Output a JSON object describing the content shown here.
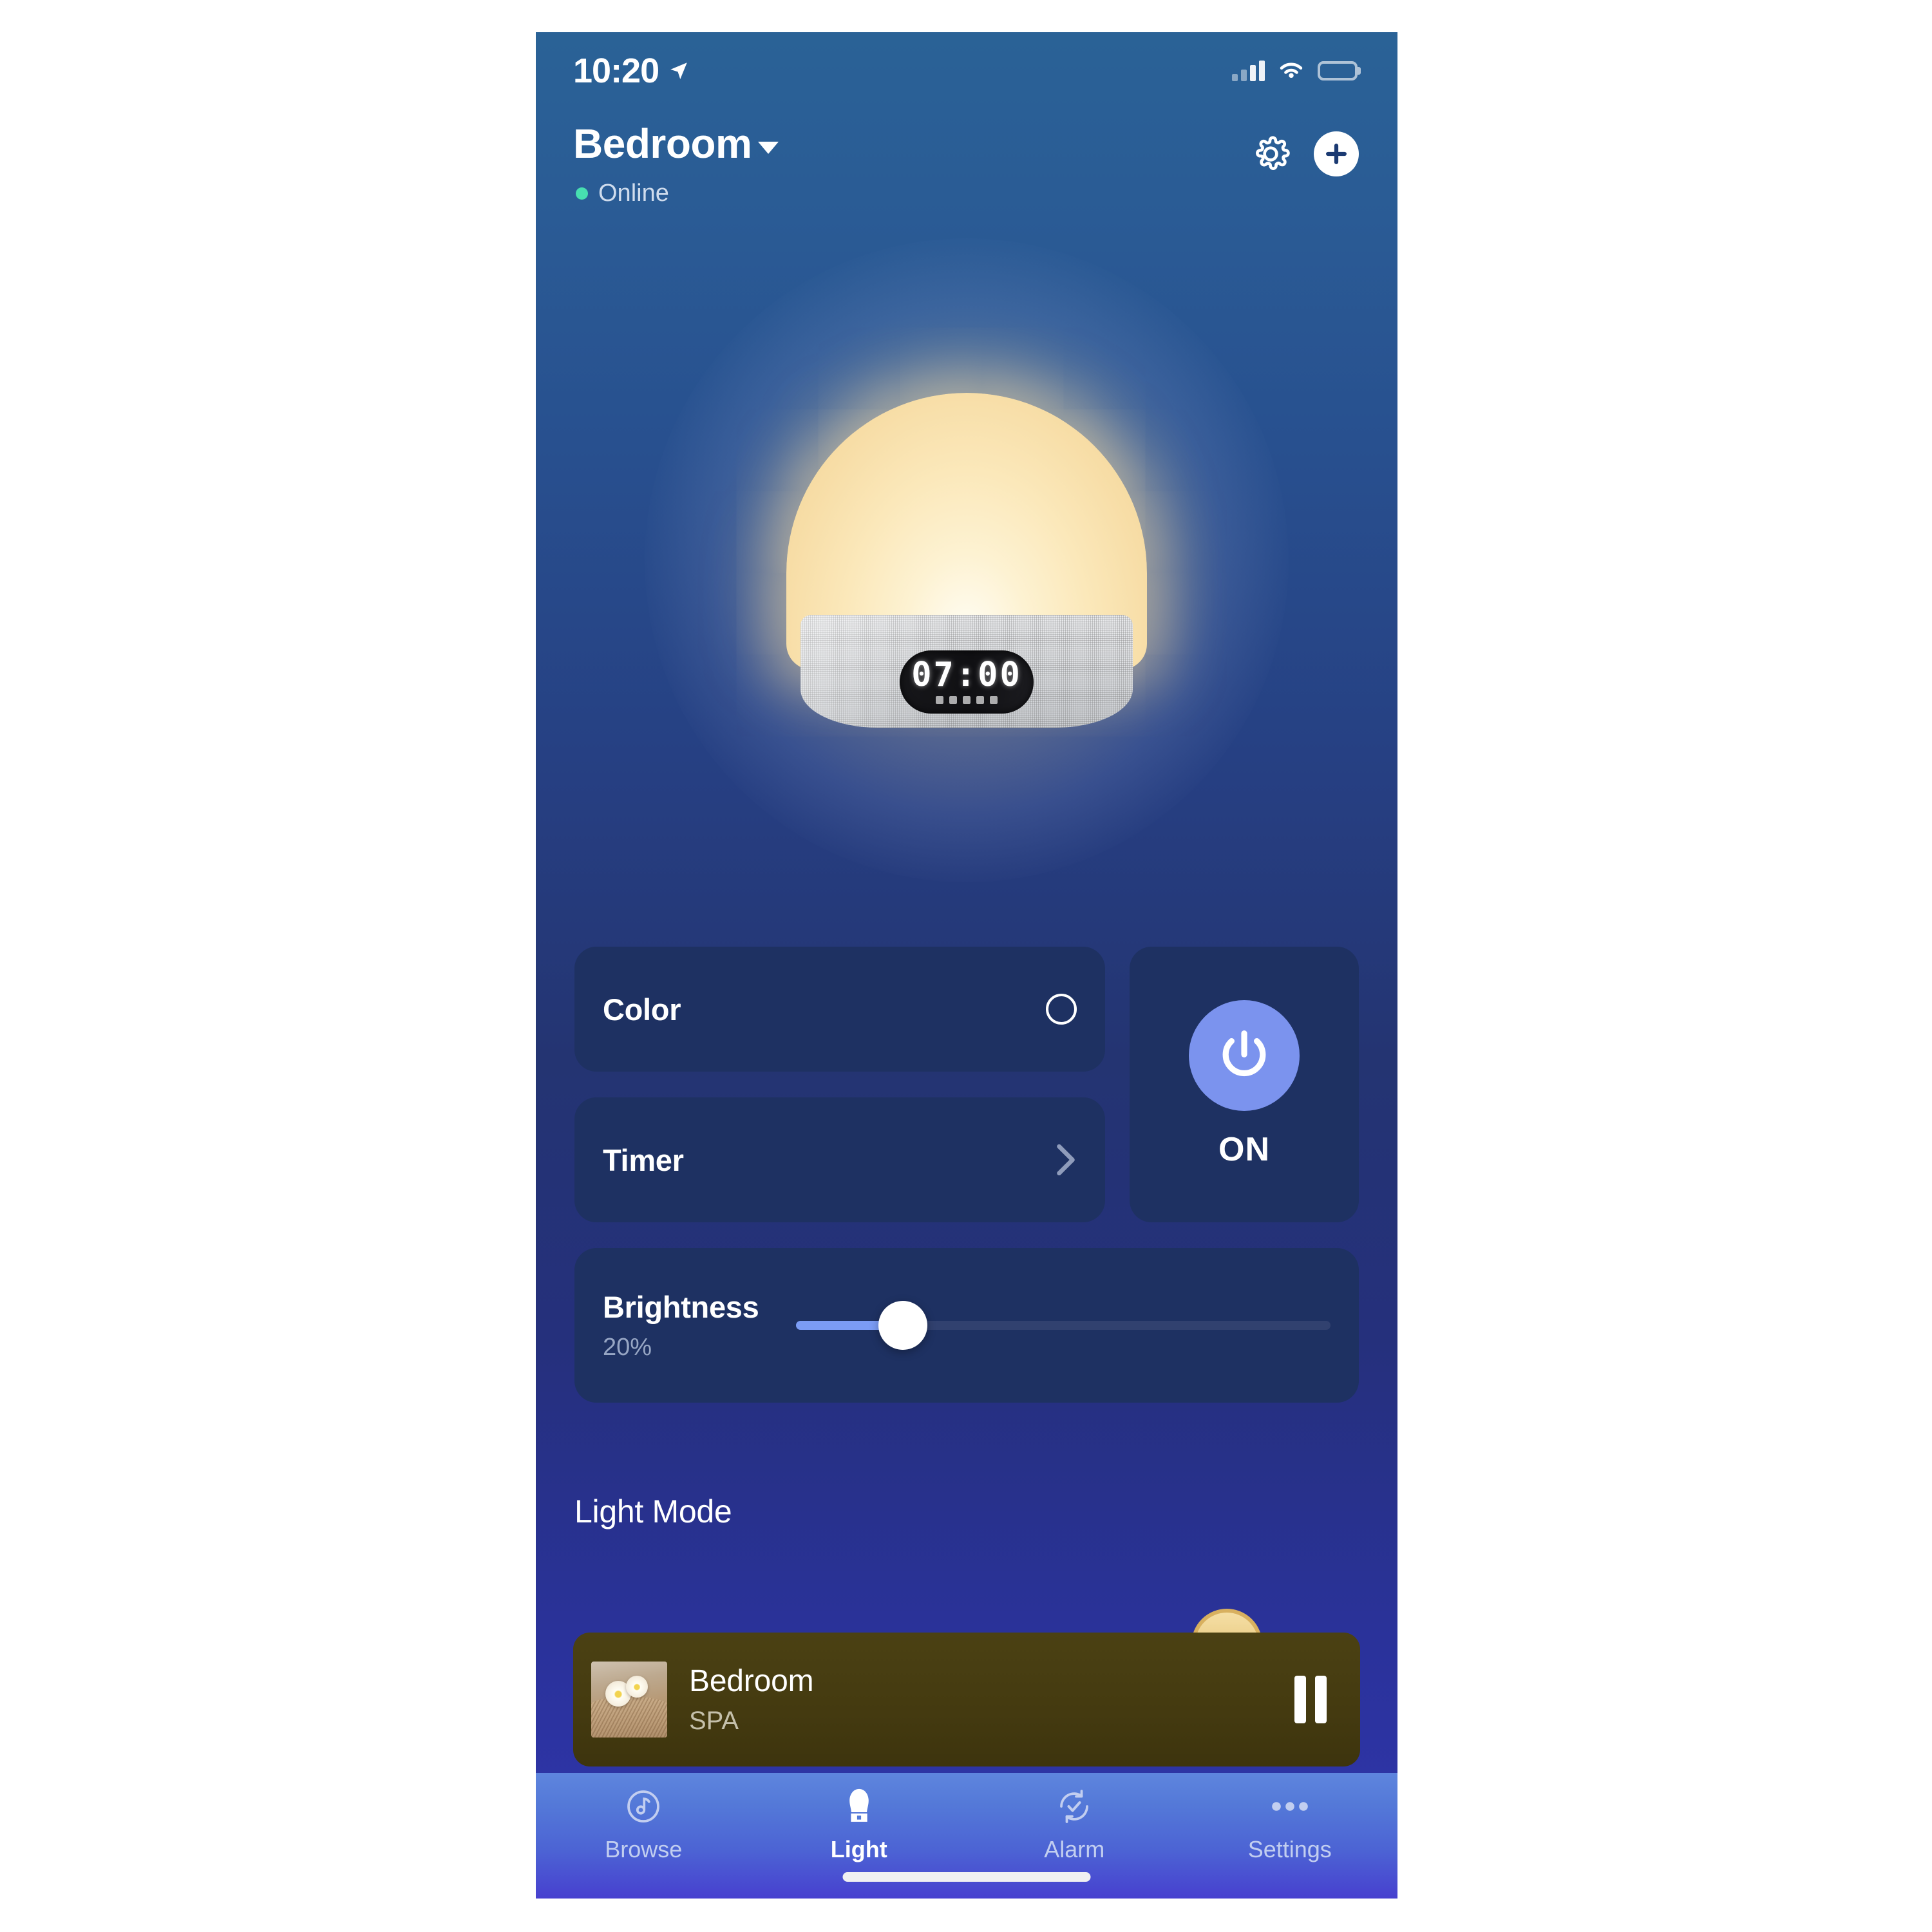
{
  "statusbar": {
    "time": "10:20",
    "location_icon": "location-arrow-icon",
    "signal_icon": "cellular-signal-icon",
    "wifi_icon": "wifi-icon",
    "battery_icon": "battery-icon"
  },
  "header": {
    "room": "Bedroom",
    "dropdown_icon": "chevron-down-icon",
    "status": "Online",
    "status_color": "#47dfb0",
    "settings_icon": "gear-icon",
    "add_icon": "plus-icon"
  },
  "device": {
    "clock_display": "07:00",
    "lamp_icon": "sunrise-lamp-illustration"
  },
  "controls": {
    "color": {
      "label": "Color",
      "swatch_icon": "color-circle-swatch"
    },
    "timer": {
      "label": "Timer",
      "chevron_icon": "chevron-right-icon"
    },
    "power": {
      "state": "ON",
      "icon": "power-icon",
      "accent": "#7b93ee"
    },
    "brightness": {
      "label": "Brightness",
      "value": "20%",
      "percent": 20,
      "track_color": "#7b9cf5"
    }
  },
  "light_mode": {
    "title": "Light Mode"
  },
  "media": {
    "title": "Bedroom",
    "subtitle": "SPA",
    "pause_icon": "pause-icon",
    "thumbnail_icon": "spa-flowers-thumbnail"
  },
  "tabs": [
    {
      "label": "Browse",
      "icon": "music-note-circle-icon",
      "active": false
    },
    {
      "label": "Light",
      "icon": "lamp-icon",
      "active": true
    },
    {
      "label": "Alarm",
      "icon": "alarm-check-icon",
      "active": false
    },
    {
      "label": "Settings",
      "icon": "ellipsis-icon",
      "active": false
    }
  ]
}
